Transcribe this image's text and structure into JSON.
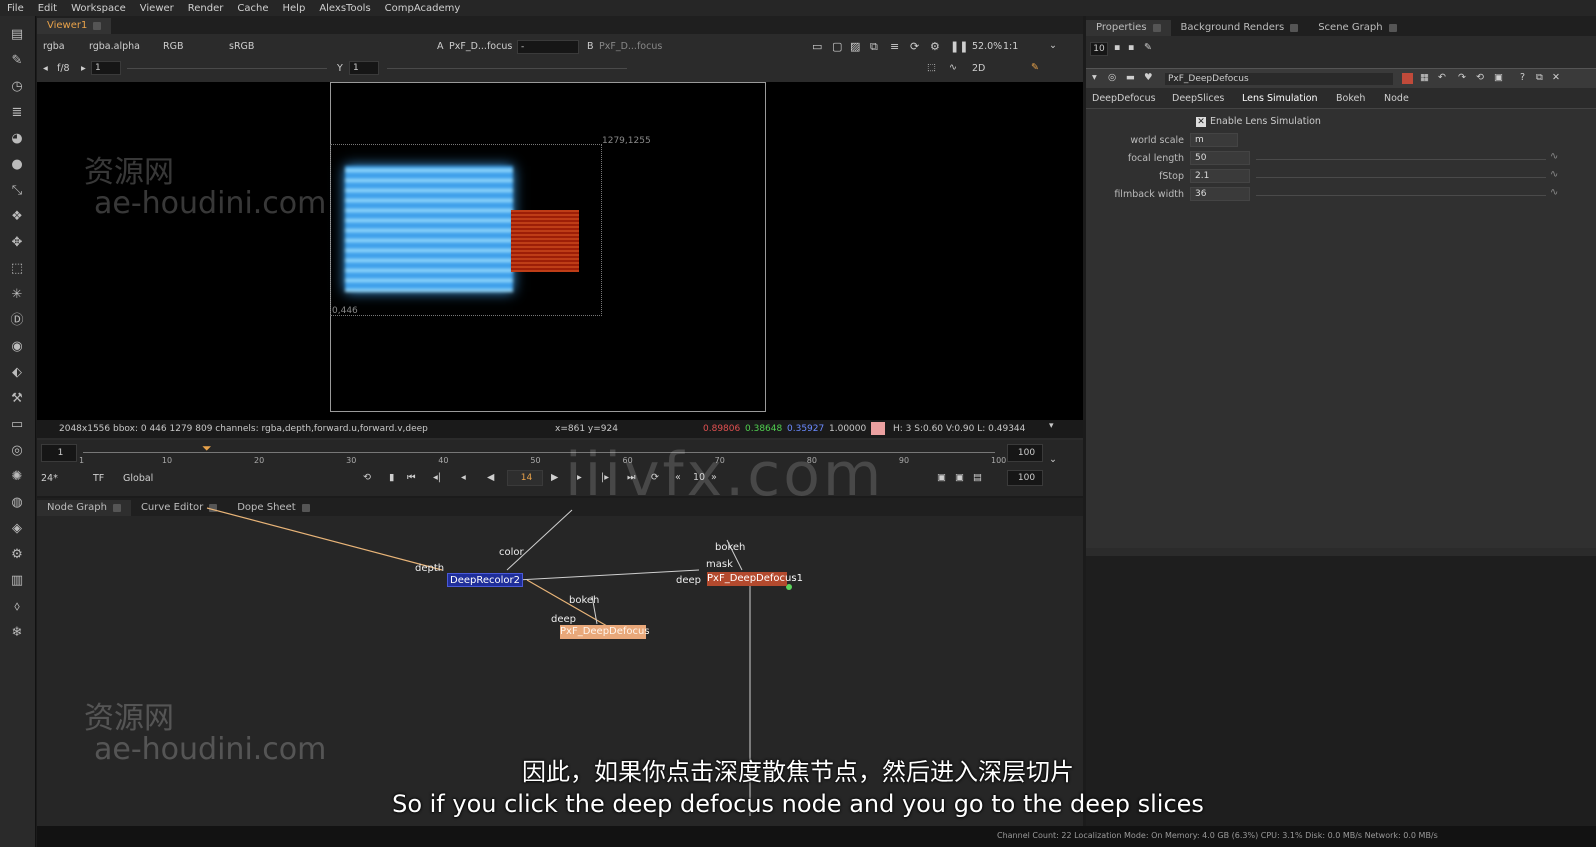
{
  "menu": [
    "File",
    "Edit",
    "Workspace",
    "Viewer",
    "Render",
    "Cache",
    "Help",
    "AlexsTools",
    "CompAcademy"
  ],
  "viewer": {
    "tab": "Viewer1",
    "channels": "rgba",
    "alpha": "rgba.alpha",
    "rgb": "RGB",
    "colorspace": "sRGB",
    "a_label": "A",
    "a_input": "PxF_D...focus",
    "b_label": "B",
    "b_input": "PxF_D...focus",
    "zoom": "52.0%",
    "ratio": "1:1",
    "fstop_label": "f/8",
    "gain": "1",
    "y_label": "Y",
    "gamma": "1",
    "view_mode": "2D",
    "bbox_top": "1279,1255",
    "bbox_bottom": "0,446",
    "status_format": "2048x1556  bbox: 0 446 1279 809 channels: rgba,depth,forward.u,forward.v,deep",
    "status_xy": "x=861 y=924",
    "status_r": "0.89806",
    "status_g": "0.38648",
    "status_b": "0.35927",
    "status_a": "1.00000",
    "status_hsv": "H:  3 S:0.60 V:0.90  L: 0.49344"
  },
  "timeline": {
    "start": "1",
    "end": "100",
    "end2": "100",
    "current": "14",
    "fps": "24*",
    "tf": "TF",
    "global": "Global",
    "step": "10",
    "ticks": [
      "1",
      "10",
      "20",
      "30",
      "40",
      "50",
      "60",
      "70",
      "80",
      "90",
      "100"
    ]
  },
  "panels": {
    "tabs": [
      "Node Graph",
      "Curve Editor",
      "Dope Sheet"
    ]
  },
  "nodes": {
    "recolor": "DeepRecolor2",
    "defocus": "PxF_DeepDefocus1",
    "defocus2": "PxF_DeepDefocus",
    "labels": {
      "depth": "depth",
      "color": "color",
      "bokeh1": "bokeh",
      "mask": "mask",
      "deep1": "deep",
      "bokeh2": "bokeh",
      "deep2": "deep"
    }
  },
  "properties": {
    "tabs": [
      "Properties",
      "Background Renders",
      "Scene Graph"
    ],
    "count": "10",
    "node_name": "PxF_DeepDefocus",
    "subtabs": [
      "DeepDefocus",
      "DeepSlices",
      "Lens Simulation",
      "Bokeh",
      "Node"
    ],
    "enable_label": "Enable Lens Simulation",
    "params": [
      {
        "label": "world scale",
        "value": "m"
      },
      {
        "label": "focal length",
        "value": "50"
      },
      {
        "label": "fStop",
        "value": "2.1"
      },
      {
        "label": "filmback width",
        "value": "36"
      }
    ]
  },
  "watermarks": {
    "cn": "资源网",
    "site": "ae-houdini.com",
    "center": "iiivfx.com"
  },
  "subtitles": {
    "cn": "因此，如果你点击深度散焦节点，然后进入深层切片",
    "en": "So if you click the deep defocus node and you go to the deep slices"
  },
  "bottom": "Channel Count: 22  Localization Mode: On  Memory: 4.0 GB (6.3%)  CPU: 3.1%  Disk: 0.0 MB/s  Network: 0.0 MB/s",
  "colors": {
    "accent": "#e8a24a",
    "node_recolor": "#1f2e9a",
    "node_defocus": "#b34a2e",
    "node_defocus2": "#e9a87a"
  }
}
